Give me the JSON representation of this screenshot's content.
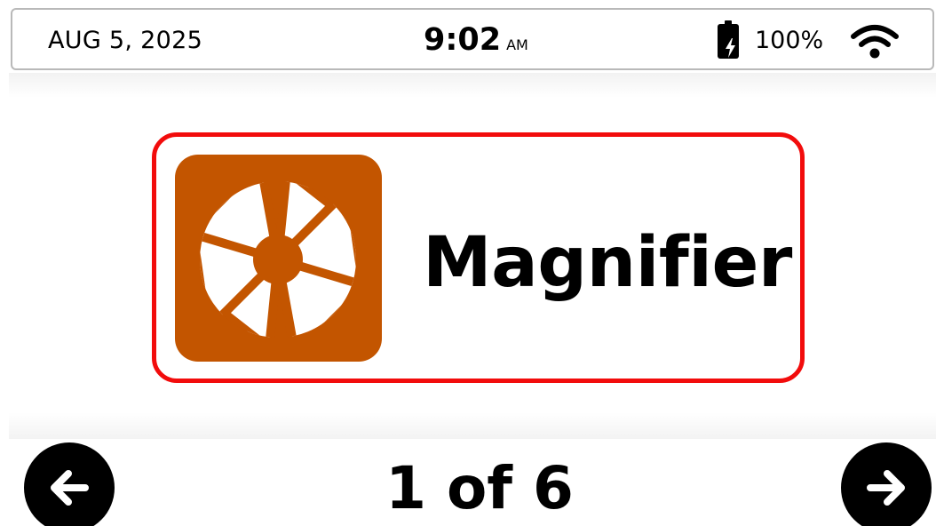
{
  "status_bar": {
    "date": "AUG 5, 2025",
    "time": "9:02",
    "ampm": "AM",
    "battery_level": "100%",
    "battery_icon": "battery-charging-icon",
    "wifi_icon": "wifi-icon"
  },
  "carousel": {
    "selected_app": {
      "label": "Magnifier",
      "icon": "camera-aperture-icon",
      "icon_background": "#c35500",
      "highlight_color": "#f20c0c"
    },
    "page_indicator": "1 of 6",
    "prev_icon": "arrow-left-icon",
    "next_icon": "arrow-right-icon"
  }
}
